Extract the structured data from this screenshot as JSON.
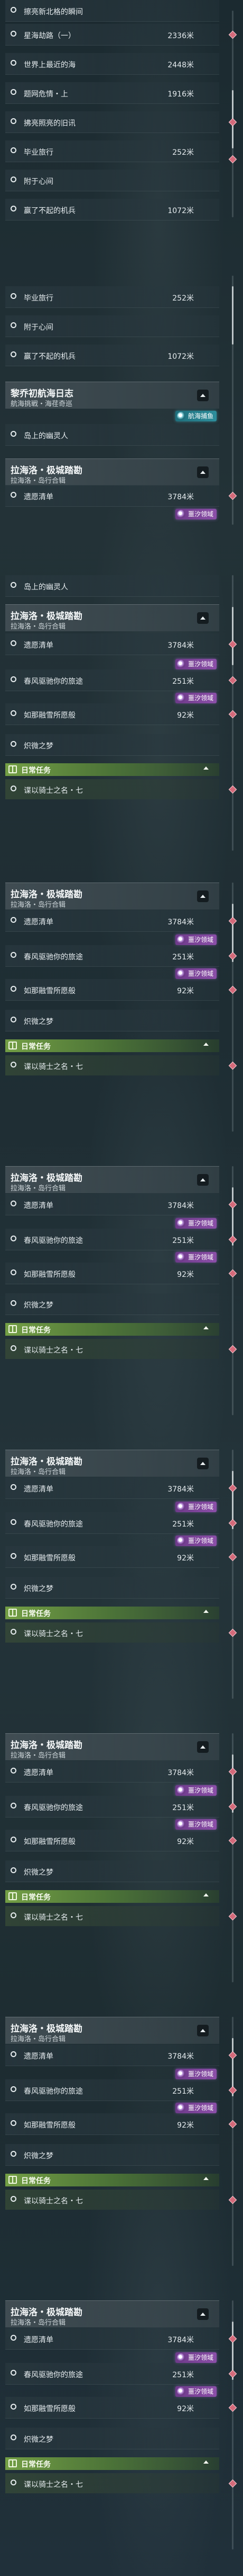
{
  "dist_unit": "米",
  "top_list": [
    {
      "name": "擦亮新北格的瞬间",
      "dist": ""
    },
    {
      "name": "星海劫路（一）",
      "dist": "2336"
    },
    {
      "name": "世界上最近的海",
      "dist": "2448"
    },
    {
      "name": "题网危情・上",
      "dist": "1916"
    },
    {
      "name": "拂亮照亮的旧讯",
      "dist": ""
    },
    {
      "name": "毕业旅行",
      "dist": "252"
    },
    {
      "name": "附于心间",
      "dist": ""
    },
    {
      "name": "赢了不起的机兵",
      "dist": "1072"
    }
  ],
  "second_list": [
    {
      "name": "毕业旅行",
      "dist": "252"
    },
    {
      "name": "附于心间",
      "dist": ""
    },
    {
      "name": "赢了不起的机兵",
      "dist": "1072"
    }
  ],
  "voyage": {
    "title": "黎乔初航海日志",
    "subtitle": "航海挑戦・海荏奇巡",
    "badge": "航海捕鱼",
    "item": "岛上的幽灵人"
  },
  "extra_item": "岛上的幽灵人",
  "region": {
    "title": "拉海洛・极城踏勘",
    "subtitle": "拉海洛・岛行合辑",
    "badge": "噩汐领域",
    "items": [
      {
        "name": "遗愿清单",
        "dist": "3784"
      },
      {
        "name": "春风驱驰你的旅途",
        "dist": "251"
      },
      {
        "name": "如那融雪所愿般",
        "dist": "92"
      },
      {
        "name": "炽微之梦",
        "dist": ""
      }
    ]
  },
  "daily": {
    "label": "日常任务",
    "item": "谍以骑士之名・七"
  },
  "colors": {
    "accent_purple": "#8b4fa8",
    "daily_green": "#78a546",
    "marker_pink": "#d46a7a"
  }
}
